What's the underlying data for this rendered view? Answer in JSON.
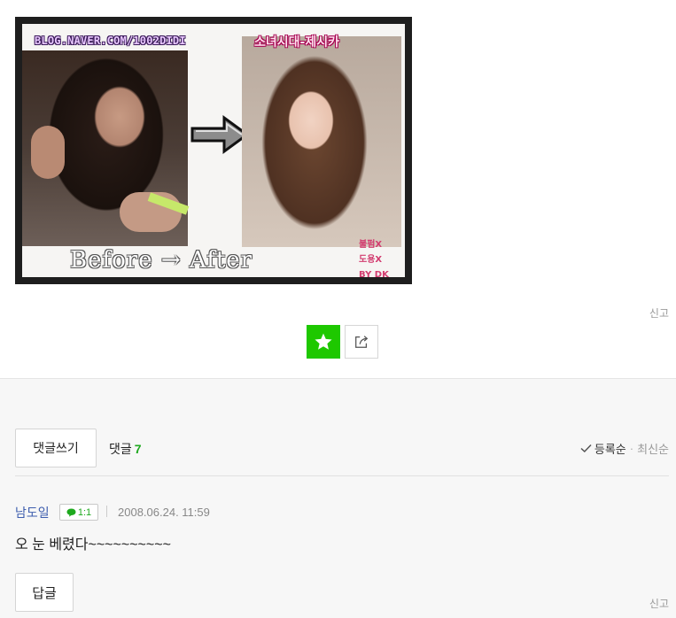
{
  "post_image": {
    "watermark_blog": "BLOG.NAVER.COM/1002DIDI",
    "watermark_title": "소녀시대-제시카",
    "caption": "Before → After",
    "side_note_lines": [
      "불펌X",
      "도용X",
      "BY DK"
    ]
  },
  "actions": {
    "report_label": "신고",
    "star_icon": "star-icon",
    "share_icon": "share-icon",
    "accent_color": "#1ec800"
  },
  "comments": {
    "write_label": "댓글쓰기",
    "count_label": "댓글",
    "count": "7",
    "sort_active": "등록순",
    "sort_sep": "·",
    "sort_inactive": "최신순",
    "items": [
      {
        "author": "남도일",
        "chat_badge": "1:1",
        "timestamp": "2008.06.24. 11:59",
        "body": "오 눈 베렸다~~~~~~~~~~",
        "reply_label": "답글",
        "report_label": "신고"
      }
    ]
  }
}
